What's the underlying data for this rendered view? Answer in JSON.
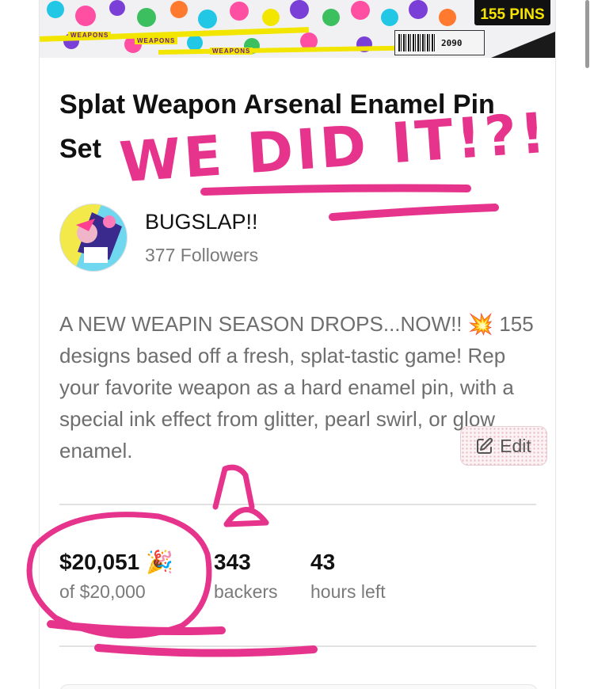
{
  "banner": {
    "tag": "155 PINS",
    "ticket_code": "2090",
    "labels": [
      "WEAPONS",
      "WEAPONS",
      "WEAPONS"
    ],
    "colors": [
      "#ff4fa3",
      "#22c7e6",
      "#7a3fd6",
      "#f2e600",
      "#3bbf5f",
      "#ff7a2e"
    ]
  },
  "project": {
    "title": "Splat Weapon Arsenal Enamel Pin Set",
    "description": "A NEW WEAPIN SEASON DROPS...NOW!! 💥 155 designs based off a fresh, splat-tastic game! Rep your favorite weapon as a hard enamel pin, with a special ink effect from glitter, pearl swirl, or glow enamel.",
    "edit_label": "Edit",
    "edit_icon": "pencil-square-icon"
  },
  "creator": {
    "name": "BUGSLAP!!",
    "followers": "377 Followers",
    "avatar_icon": "creator-avatar-illustration"
  },
  "stats": [
    {
      "value": "$20,051 🎉",
      "label": "of $20,000"
    },
    {
      "value": "343",
      "label": "backers"
    },
    {
      "value": "43",
      "label": "hours left"
    }
  ],
  "annotation": {
    "handwriting": "WE DID IT!?!",
    "color": "#e6348d"
  }
}
